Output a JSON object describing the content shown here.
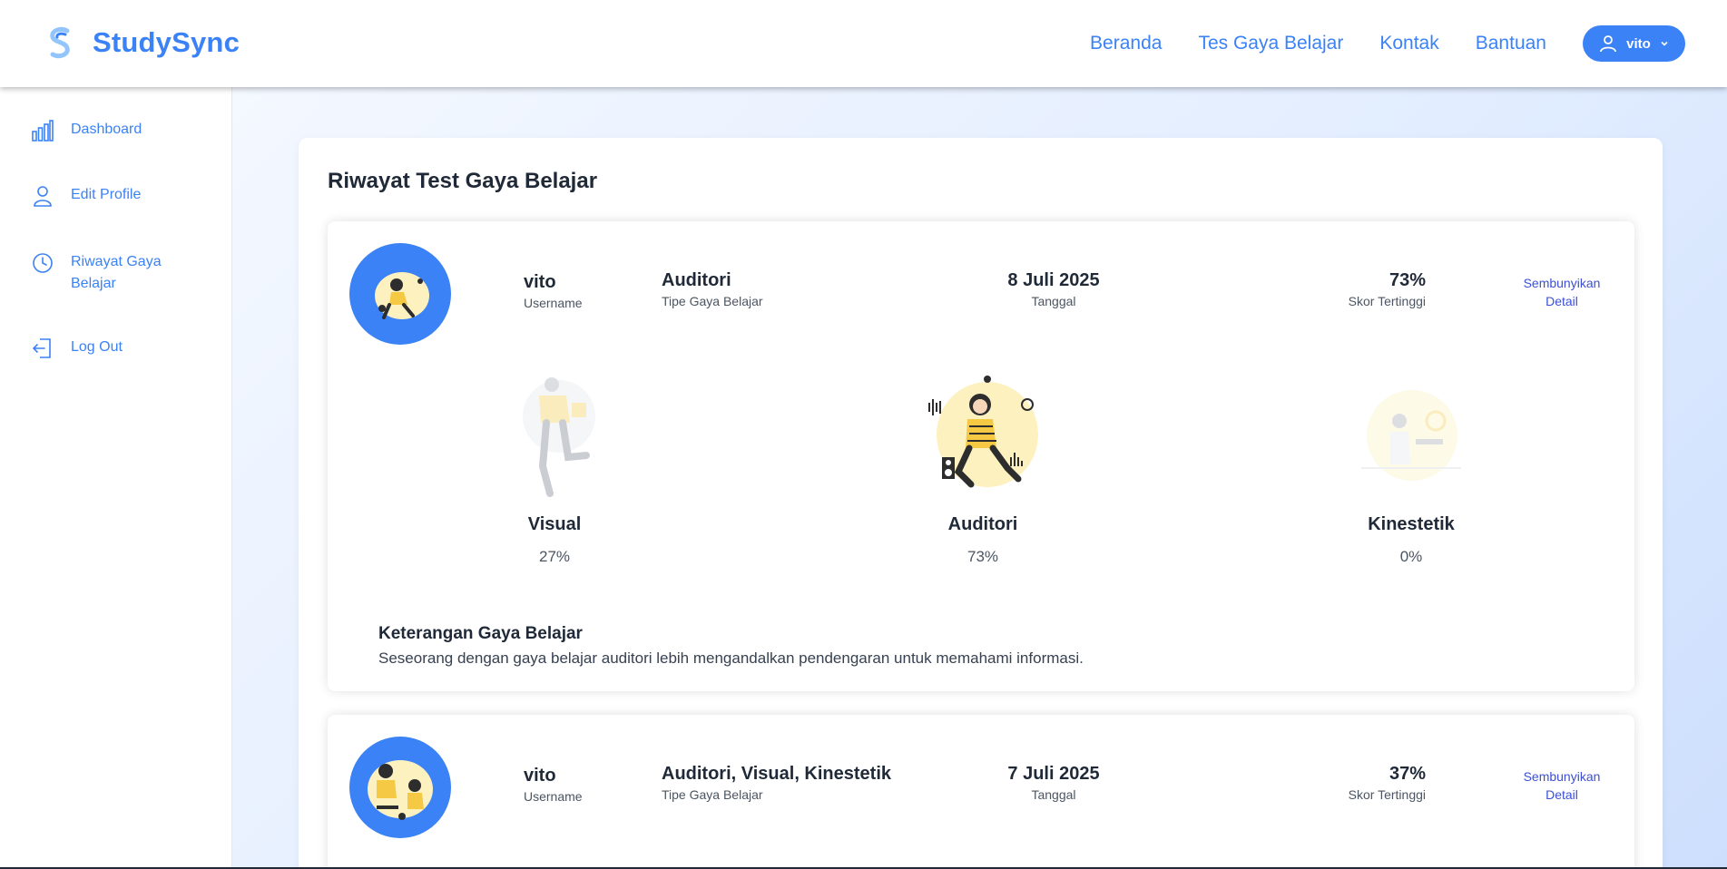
{
  "brand": {
    "name": "StudySync",
    "accent": "#3b82f6"
  },
  "nav": {
    "links": [
      "Beranda",
      "Tes Gaya Belajar",
      "Kontak",
      "Bantuan"
    ],
    "user": {
      "name": "vito",
      "icon": "user-icon"
    }
  },
  "sidebar": {
    "items": [
      {
        "label": "Dashboard",
        "icon": "bar-chart-icon"
      },
      {
        "label": "Edit Profile",
        "icon": "user-icon"
      },
      {
        "label": "Riwayat Gaya Belajar",
        "icon": "clock-icon"
      },
      {
        "label": "Log Out",
        "icon": "logout-icon"
      }
    ]
  },
  "panel": {
    "title": "Riwayat Test Gaya Belajar"
  },
  "history": [
    {
      "username": "vito",
      "username_label": "Username",
      "type": "Auditori",
      "type_label": "Tipe Gaya Belajar",
      "date": "8 Juli 2025",
      "date_label": "Tanggal",
      "score": "73%",
      "score_label": "Skor Tertinggi",
      "toggle": "Sembunyikan Detail",
      "styles": [
        {
          "name": "Visual",
          "percent": "27%",
          "highlighted": false
        },
        {
          "name": "Auditori",
          "percent": "73%",
          "highlighted": true
        },
        {
          "name": "Kinestetik",
          "percent": "0%",
          "highlighted": false
        }
      ],
      "description_title": "Keterangan Gaya Belajar",
      "description": "Seseorang dengan gaya belajar auditori lebih mengandalkan pendengaran untuk memahami informasi."
    },
    {
      "username": "vito",
      "username_label": "Username",
      "type": "Auditori, Visual, Kinestetik",
      "type_label": "Tipe Gaya Belajar",
      "date": "7 Juli 2025",
      "date_label": "Tanggal",
      "score": "37%",
      "score_label": "Skor Tertinggi",
      "toggle": "Sembunyikan Detail"
    }
  ]
}
